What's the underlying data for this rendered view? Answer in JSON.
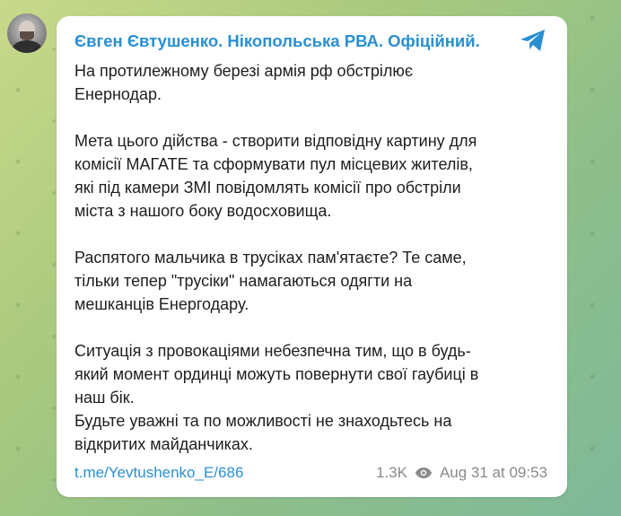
{
  "post": {
    "channel_name": "Євген Євтушенко. Нікопольська РВА. Офіційний.",
    "paragraphs": [
      [
        "На протилежному березі армія рф обстрілює",
        "Енернодар."
      ],
      [
        "Мета цього дійства - створити відповідну картину для",
        "комісії МАГАТЕ та сформувати пул місцевих жителів,",
        "які під камери ЗМІ повідомлять комісії про обстріли",
        "міста з нашого боку водосховища."
      ],
      [
        "Распятого мальчика в трусіках пам'ятаєте? Те саме,",
        "тільки тепер \"трусіки\" намагаються одягти на",
        "мешканців Енергодару."
      ],
      [
        "Ситуація з провокаціями небезпечна тим, що в будь-",
        "який момент ординці можуть повернути свої гаубиці в",
        "наш бік.",
        "Будьте уважні та по можливості не знаходьтесь на",
        "відкритих майданчиках."
      ]
    ],
    "link_text": "t.me/Yevtushenko_E/686",
    "views": "1.3K",
    "timestamp": "Aug 31 at 09:53"
  },
  "icons": {
    "avatar": "channel-avatar",
    "telegram": "telegram-logo-icon",
    "views": "eye-icon"
  },
  "colors": {
    "accent": "#2a8fd1",
    "text": "#1e1e1e",
    "meta": "#8a8a8a",
    "card": "#ffffff"
  }
}
